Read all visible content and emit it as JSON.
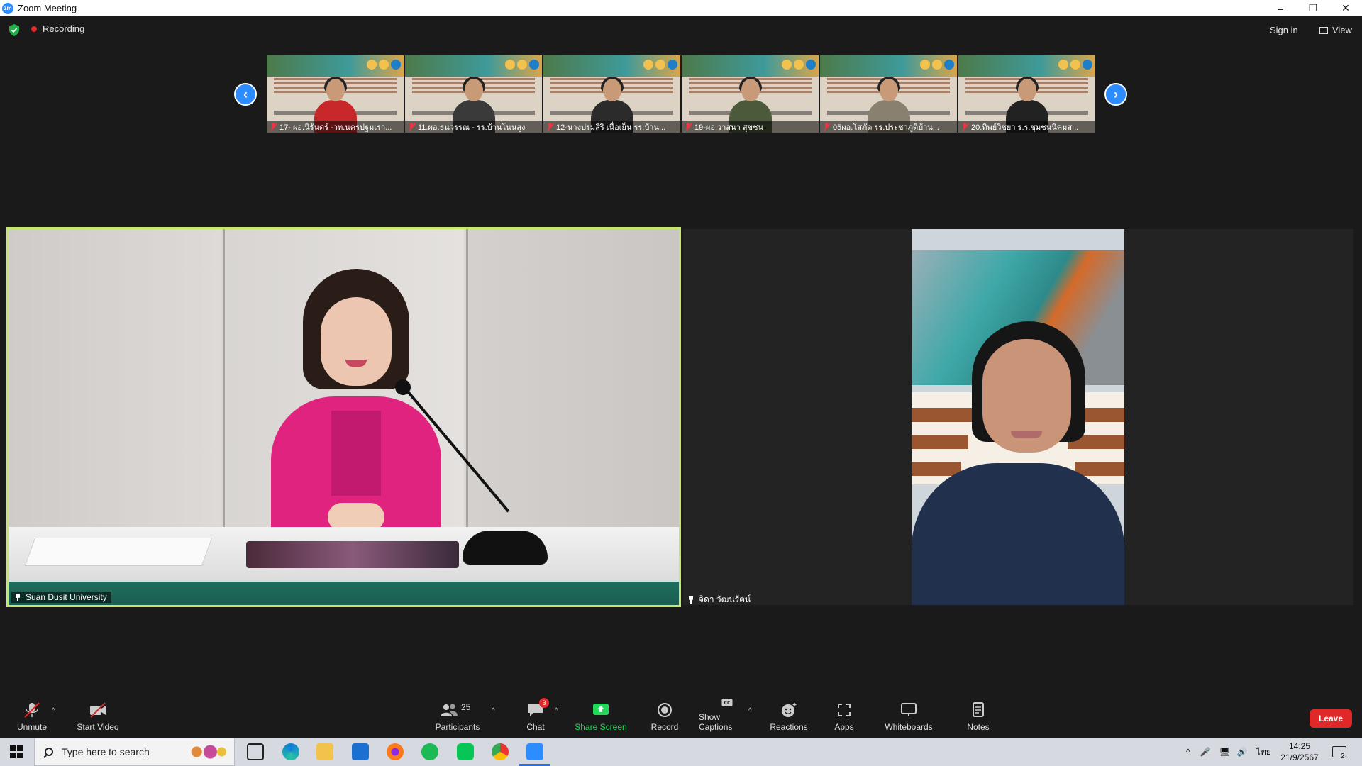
{
  "window": {
    "title": "Zoom Meeting",
    "app_logo": "zm",
    "controls": [
      "–",
      "❐",
      "✕"
    ]
  },
  "header": {
    "recording_label": "Recording",
    "sign_in": "Sign in",
    "view": "View"
  },
  "gallery": {
    "prev_arrow": "‹",
    "next_arrow": "›",
    "thumbnails": [
      {
        "name": "17- ผอ.นิรันดร์ -วท.นครปฐมเรา...",
        "shirt": "#c8282a"
      },
      {
        "name": "11.ผอ.ธนวรรณ - รร.บ้านโนนสูง",
        "shirt": "#3a3a3a"
      },
      {
        "name": "12-นางปรมสิริ เนื่อเย็น รร.บ้าน...",
        "shirt": "#2b2b2b"
      },
      {
        "name": "19-ผอ.วาสนา สุขชน",
        "shirt": "#4a5a3a"
      },
      {
        "name": "05ผอ.โสภัด  รร.ประชาภูติบ้าน...",
        "shirt": "#8a8070"
      },
      {
        "name": "20.ทิพย์วิชยา ร.ร.ชุมชนนิคมส...",
        "shirt": "#222222"
      }
    ]
  },
  "main_tiles": {
    "active_speaker": {
      "name": "Suan Dusit University",
      "border_color": "#c5e86c"
    },
    "second": {
      "name": "จิดา วัฒนรัตน์"
    }
  },
  "toolbar": {
    "unmute": "Unmute",
    "start_video": "Start Video",
    "participants": "Participants",
    "participants_count": "25",
    "chat": "Chat",
    "chat_badge": "3",
    "share_screen": "Share Screen",
    "record": "Record",
    "show_captions": "Show Captions",
    "reactions": "Reactions",
    "apps": "Apps",
    "whiteboards": "Whiteboards",
    "notes": "Notes",
    "leave": "Leave",
    "share_color": "#23d959"
  },
  "taskbar": {
    "search_placeholder": "Type here to search",
    "language": "ไทย",
    "time": "14:25",
    "date": "21/9/2567",
    "notification_count": "2"
  }
}
